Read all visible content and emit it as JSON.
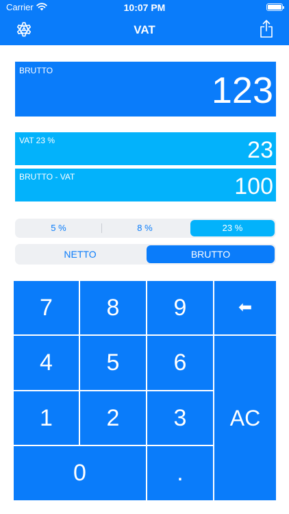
{
  "status_bar": {
    "carrier": "Carrier",
    "time": "10:07 PM"
  },
  "nav": {
    "title": "VAT",
    "left_icon": "gear-icon",
    "right_icon": "share-icon"
  },
  "display": {
    "label": "BRUTTO",
    "value": "123"
  },
  "vat_row": {
    "label": "VAT 23 %",
    "value": "23"
  },
  "net_row": {
    "label": "BRUTTO - VAT",
    "value": "100"
  },
  "rates": {
    "options": [
      "5 %",
      "8 %",
      "23 %"
    ],
    "selected": "23 %"
  },
  "mode": {
    "options": [
      "NETTO",
      "BRUTTO"
    ],
    "selected": "BRUTTO"
  },
  "keypad": {
    "keys": {
      "seven": "7",
      "eight": "8",
      "nine": "9",
      "backspace": "⬅",
      "four": "4",
      "five": "5",
      "six": "6",
      "one": "1",
      "two": "2",
      "three": "3",
      "clear": "AC",
      "zero": "0",
      "decimal": "."
    }
  },
  "colors": {
    "primary": "#0a7cfa",
    "secondary": "#03b2fb",
    "segment_bg": "#eef0f3",
    "text_light": "#ffffff"
  }
}
